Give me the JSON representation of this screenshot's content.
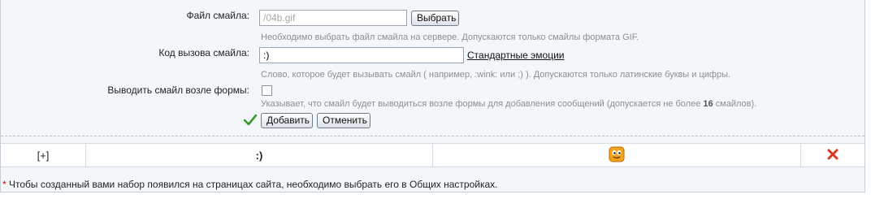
{
  "form": {
    "file_label": "Файл смайла:",
    "file_value": "/04b.gif",
    "choose_button": "Выбрать",
    "file_hint": "Необходимо выбрать файл смайла на сервере. Допускаются только смайлы формата GIF.",
    "code_label": "Код вызова смайла:",
    "code_value": ":)",
    "standard_link": "Стандартные эмоции",
    "code_hint": "Слово, которое будет вызывать смайл ( например, :wink: или ;) ). Допускаются только латинские буквы и цифры.",
    "show_label": "Выводить смайл возле формы:",
    "show_checked": false,
    "show_hint_before": "Указывает, что смайл будет выводиться возле формы для добавления сообщений (допускается не более ",
    "show_hint_count": "16",
    "show_hint_after": " смайлов).",
    "add_button": "Добавить",
    "cancel_button": "Отменить"
  },
  "smiley_row": {
    "expand": "[+]",
    "code": ":)",
    "icon": "smiley-face-icon",
    "delete_icon": "delete-x-icon"
  },
  "footer": {
    "star": "*",
    "note": " Чтобы созданный вами набор появился на страницах сайта, необходимо выбрать его в Общих настройках."
  },
  "colors": {
    "panel_bg": "#f4f7fa",
    "check_green": "#3a9a2a",
    "delete_red": "#d9381e",
    "smiley_orange": "#f3a21b"
  }
}
